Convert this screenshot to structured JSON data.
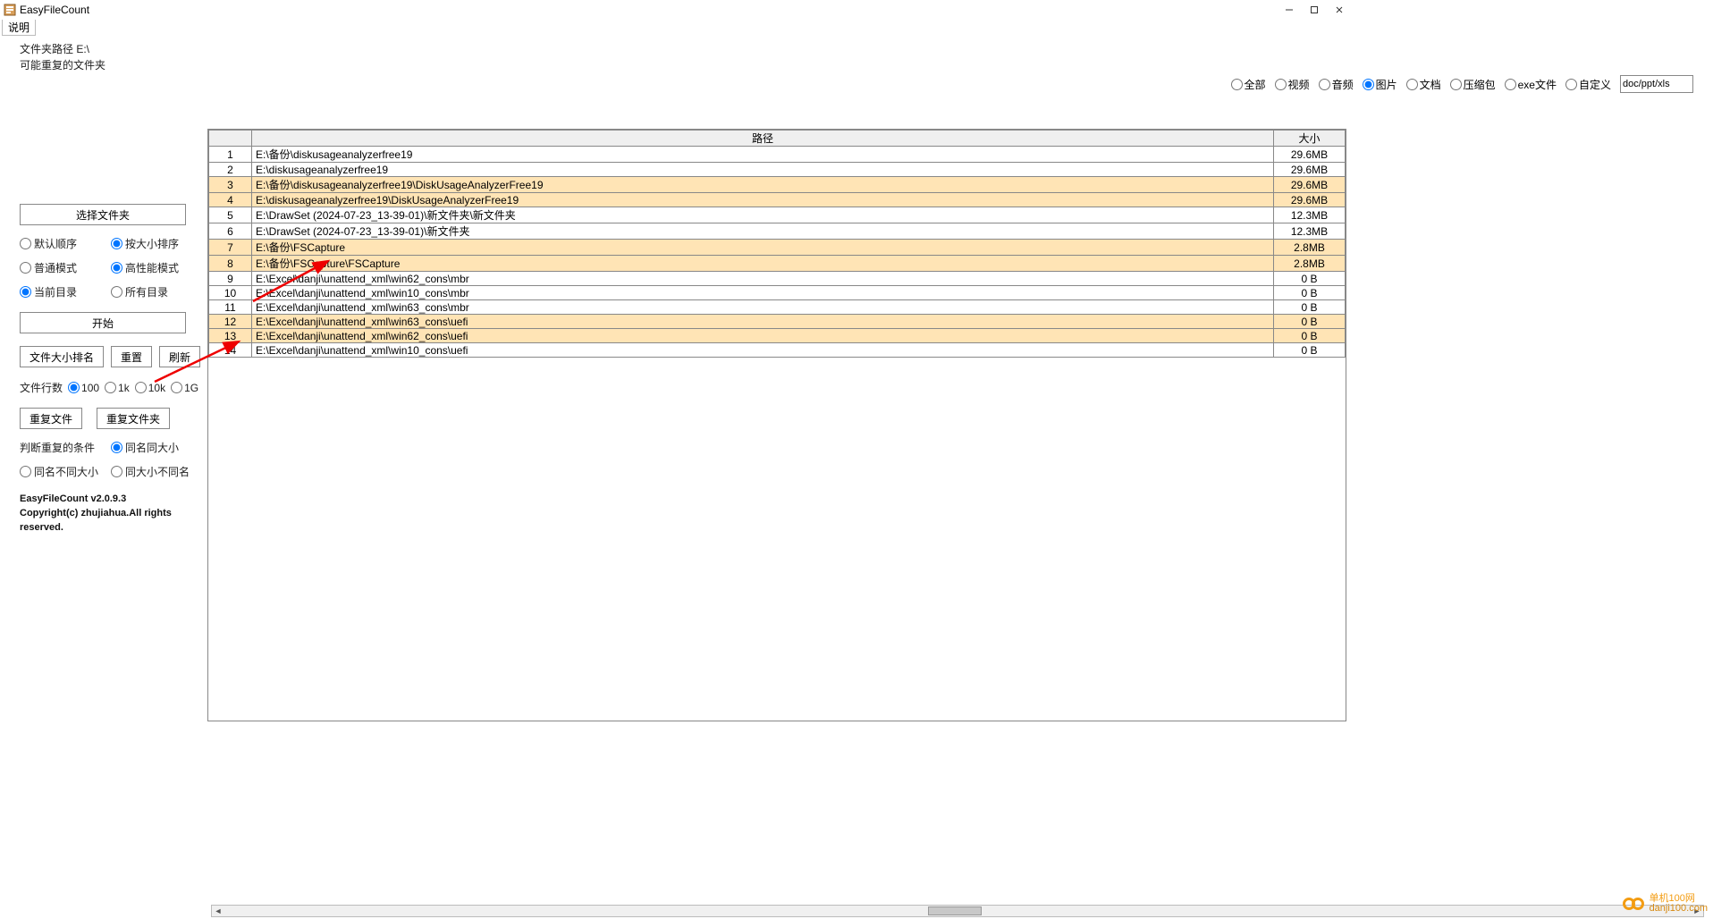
{
  "app": {
    "title": "EasyFileCount"
  },
  "menu": {
    "help": "说明"
  },
  "info": {
    "path_label": "文件夹路径 E:\\",
    "dup_label": "可能重复的文件夹"
  },
  "filter": {
    "all": "全部",
    "video": "视频",
    "audio": "音频",
    "image": "图片",
    "doc": "文档",
    "archive": "压缩包",
    "exe": "exe文件",
    "custom": "自定义",
    "custom_value": "doc/ppt/xls"
  },
  "table": {
    "col_path": "路径",
    "col_size": "大小",
    "rows": [
      {
        "n": "1",
        "path": "E:\\备份\\diskusageanalyzerfree19",
        "size": "29.6MB",
        "hl": false
      },
      {
        "n": "2",
        "path": "E:\\diskusageanalyzerfree19",
        "size": "29.6MB",
        "hl": false
      },
      {
        "n": "3",
        "path": "E:\\备份\\diskusageanalyzerfree19\\DiskUsageAnalyzerFree19",
        "size": "29.6MB",
        "hl": true
      },
      {
        "n": "4",
        "path": "E:\\diskusageanalyzerfree19\\DiskUsageAnalyzerFree19",
        "size": "29.6MB",
        "hl": true
      },
      {
        "n": "5",
        "path": "E:\\DrawSet (2024-07-23_13-39-01)\\新文件夹\\新文件夹",
        "size": "12.3MB",
        "hl": false
      },
      {
        "n": "6",
        "path": "E:\\DrawSet (2024-07-23_13-39-01)\\新文件夹",
        "size": "12.3MB",
        "hl": false
      },
      {
        "n": "7",
        "path": "E:\\备份\\FSCapture",
        "size": "2.8MB",
        "hl": true
      },
      {
        "n": "8",
        "path": "E:\\备份\\FSCapture\\FSCapture",
        "size": "2.8MB",
        "hl": true
      },
      {
        "n": "9",
        "path": "E:\\Excel\\danji\\unattend_xml\\win62_cons\\mbr",
        "size": "0 B",
        "hl": false
      },
      {
        "n": "10",
        "path": "E:\\Excel\\danji\\unattend_xml\\win10_cons\\mbr",
        "size": "0 B",
        "hl": false
      },
      {
        "n": "11",
        "path": "E:\\Excel\\danji\\unattend_xml\\win63_cons\\mbr",
        "size": "0 B",
        "hl": false
      },
      {
        "n": "12",
        "path": "E:\\Excel\\danji\\unattend_xml\\win63_cons\\uefi",
        "size": "0 B",
        "hl": true
      },
      {
        "n": "13",
        "path": "E:\\Excel\\danji\\unattend_xml\\win62_cons\\uefi",
        "size": "0 B",
        "hl": true
      },
      {
        "n": "14",
        "path": "E:\\Excel\\danji\\unattend_xml\\win10_cons\\uefi",
        "size": "0 B",
        "hl": false
      }
    ]
  },
  "sidebar": {
    "select_folder": "选择文件夹",
    "sort_default": "默认顺序",
    "sort_size": "按大小排序",
    "mode_normal": "普通模式",
    "mode_hiperf": "高性能模式",
    "scope_current": "当前目录",
    "scope_all": "所有目录",
    "start": "开始",
    "rank": "文件大小排名",
    "reset": "重置",
    "refresh": "刷新",
    "rowcount_label": "文件行数",
    "rc100": "100",
    "rc1k": "1k",
    "rc10k": "10k",
    "rc1g": "1G",
    "dup_files": "重复文件",
    "dup_folders": "重复文件夹",
    "cond_label": "判断重复的条件",
    "cond_same_name_size": "同名同大小",
    "cond_name_diff_size": "同名不同大小",
    "cond_size_diff_name": "同大小不同名"
  },
  "footer": {
    "version": "EasyFileCount v2.0.9.3",
    "copyright": "Copyright(c) zhujiahua.All rights reserved."
  },
  "watermark": {
    "line1": "单机100网",
    "line2": "danji100.com"
  }
}
